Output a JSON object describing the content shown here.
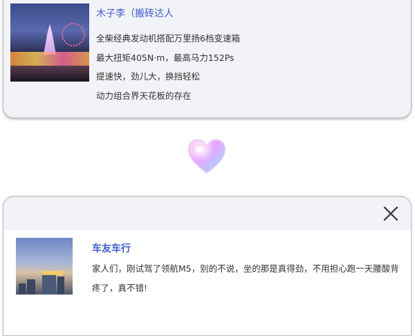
{
  "top_card": {
    "author": "木子李（搬砖达人",
    "lines": [
      "全柴经典发动机搭配万里扬6档变速箱",
      "最大扭矩405N·m，最高马力152Ps",
      "提速快，劲儿大，换挡轻松",
      "动力组合界天花板的存在"
    ]
  },
  "bottom_card": {
    "title": "车友车行",
    "text": "家人们，刚试驾了领航M5，别的不说，坐的那是真得劲，不用担心跑一天腰酸背疼了，真不错!"
  },
  "icons": {
    "heart": "heart-icon",
    "close": "close-icon"
  },
  "colors": {
    "accent": "#3a5bd6",
    "card_bg": "#f2f3f6"
  }
}
